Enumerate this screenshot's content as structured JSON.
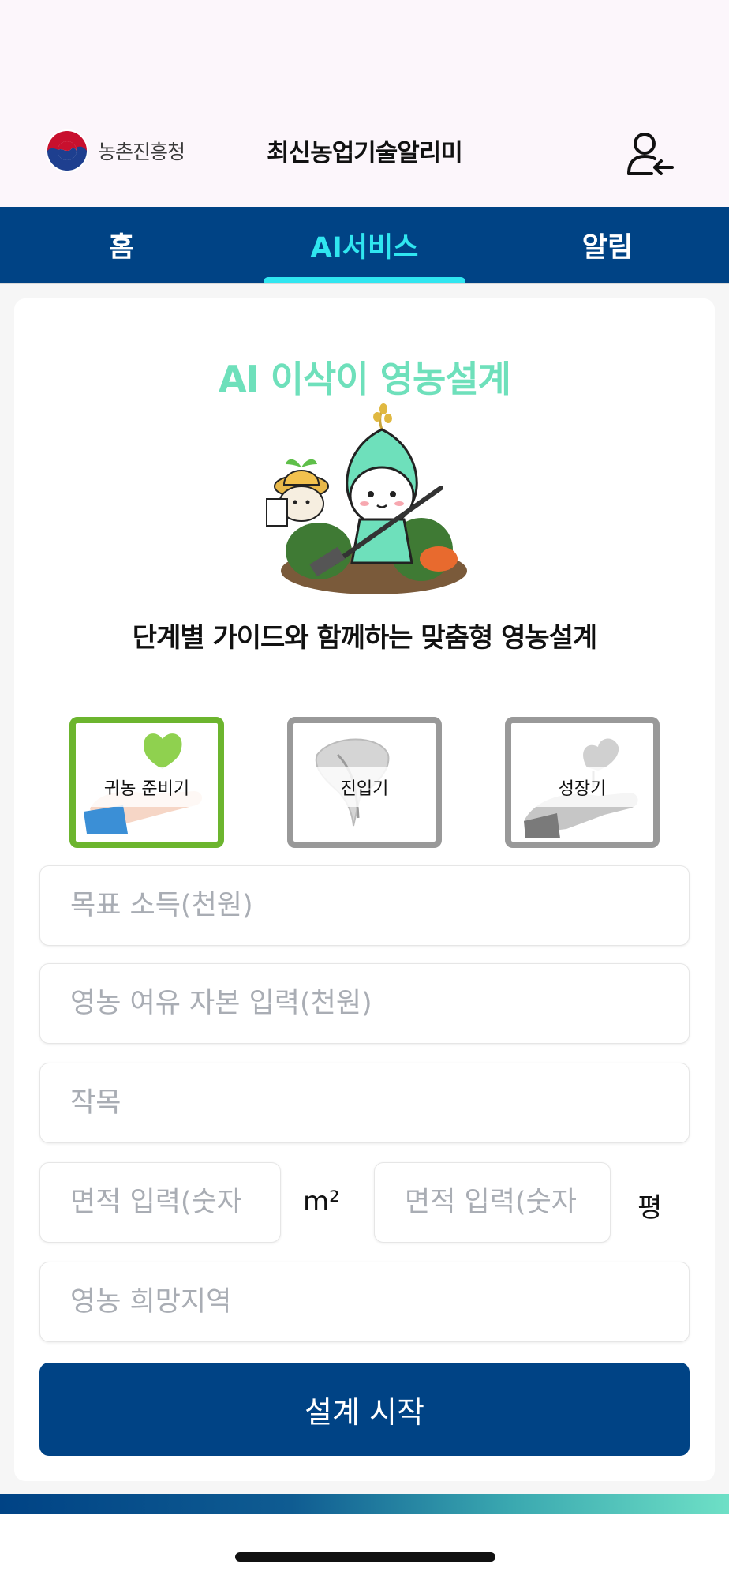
{
  "header": {
    "logo_text": "농촌진흥청",
    "app_title": "최신농업기술알리미",
    "user_icon": "user-login-icon"
  },
  "nav": {
    "tabs": [
      {
        "label": "홈",
        "active": false
      },
      {
        "label": "AI서비스",
        "active": true
      },
      {
        "label": "알림",
        "active": false
      }
    ]
  },
  "main": {
    "title": "AI 이삭이 영농설계",
    "mascot_icon": "mascot-farmer-illustration",
    "subtitle": "단계별 가이드와 함께하는 맞춤형 영농설계",
    "stages": [
      {
        "label": "귀농 준비기",
        "active": true,
        "icon": "seedling-hand-icon"
      },
      {
        "label": "진입기",
        "active": false,
        "icon": "leaf-sprout-icon"
      },
      {
        "label": "성장기",
        "active": false,
        "icon": "plant-hand-icon"
      }
    ]
  },
  "form": {
    "target_income_placeholder": "목표 소득(천원)",
    "capital_placeholder": "영농 여유 자본 입력(천원)",
    "crop_placeholder": "작목",
    "area_m2_placeholder": "면적 입력(숫자",
    "area_m2_unit": "m²",
    "area_pyeong_placeholder": "면적 입력(숫자",
    "area_pyeong_unit": "평",
    "region_placeholder": "영농 희망지역",
    "start_button": "설계 시작"
  },
  "colors": {
    "primary": "#004385",
    "accent_tab": "#30e6f0",
    "title_green": "#6ee0bb",
    "active_stage_border": "#6cb52e",
    "inactive_stage_border": "#999999"
  }
}
